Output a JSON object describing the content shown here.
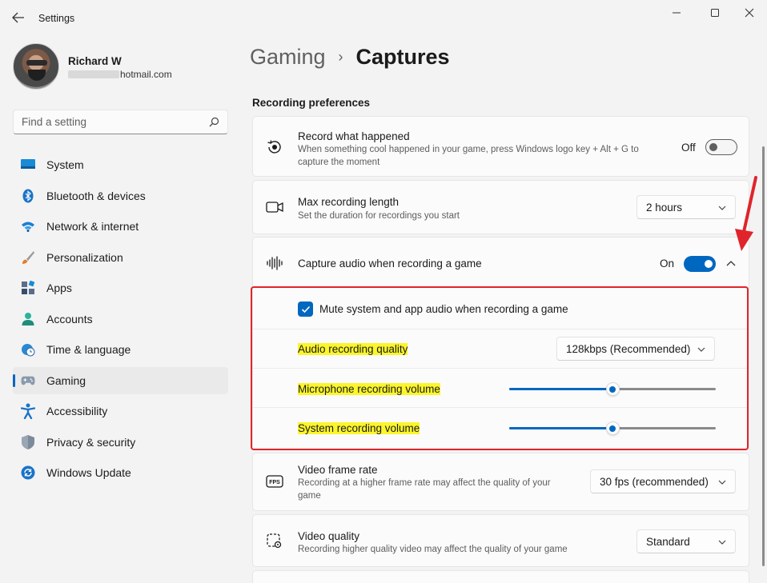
{
  "window": {
    "app_title": "Settings",
    "back_icon": "back-arrow-icon",
    "controls": [
      "minimize-icon",
      "maximize-icon",
      "close-icon"
    ]
  },
  "profile": {
    "name": "Richard W",
    "email_visible": "hotmail.com"
  },
  "search": {
    "placeholder": "Find a setting"
  },
  "sidebar": {
    "items": [
      {
        "label": "System",
        "icon": "system-icon",
        "active": false
      },
      {
        "label": "Bluetooth & devices",
        "icon": "bluetooth-icon",
        "active": false
      },
      {
        "label": "Network & internet",
        "icon": "wifi-icon",
        "active": false
      },
      {
        "label": "Personalization",
        "icon": "brush-icon",
        "active": false
      },
      {
        "label": "Apps",
        "icon": "apps-icon",
        "active": false
      },
      {
        "label": "Accounts",
        "icon": "accounts-icon",
        "active": false
      },
      {
        "label": "Time & language",
        "icon": "globe-clock-icon",
        "active": false
      },
      {
        "label": "Gaming",
        "icon": "gamepad-icon",
        "active": true
      },
      {
        "label": "Accessibility",
        "icon": "accessibility-icon",
        "active": false
      },
      {
        "label": "Privacy & security",
        "icon": "shield-icon",
        "active": false
      },
      {
        "label": "Windows Update",
        "icon": "update-icon",
        "active": false
      }
    ]
  },
  "breadcrumb": {
    "parent": "Gaming",
    "separator": "›",
    "current": "Captures"
  },
  "section_title": "Recording preferences",
  "settings": {
    "record_what_happened": {
      "title": "Record what happened",
      "description": "When something cool happened in your game, press Windows logo key + Alt + G to capture the moment",
      "state_label": "Off",
      "enabled": false
    },
    "max_recording_length": {
      "title": "Max recording length",
      "description": "Set the duration for recordings you start",
      "value": "2 hours"
    },
    "capture_audio": {
      "title": "Capture audio when recording a game",
      "state_label": "On",
      "enabled": true,
      "expanded": true,
      "mute_option": {
        "label": "Mute system and app audio when recording a game",
        "checked": true
      },
      "audio_quality": {
        "label": "Audio recording quality",
        "value": "128kbps (Recommended)"
      },
      "microphone_volume": {
        "label": "Microphone recording volume",
        "level_fraction": 0.5
      },
      "system_volume": {
        "label": "System recording volume",
        "level_fraction": 0.5
      }
    },
    "video_frame_rate": {
      "title": "Video frame rate",
      "description": "Recording at a higher frame rate may affect the quality of your game",
      "value": "30 fps (recommended)"
    },
    "video_quality": {
      "title": "Video quality",
      "description": "Recording higher quality video may affect the quality of your game",
      "value": "Standard"
    }
  },
  "colors": {
    "accent": "#0067c0",
    "highlight": "#fbf52c",
    "annotation_red": "#e0242b"
  }
}
